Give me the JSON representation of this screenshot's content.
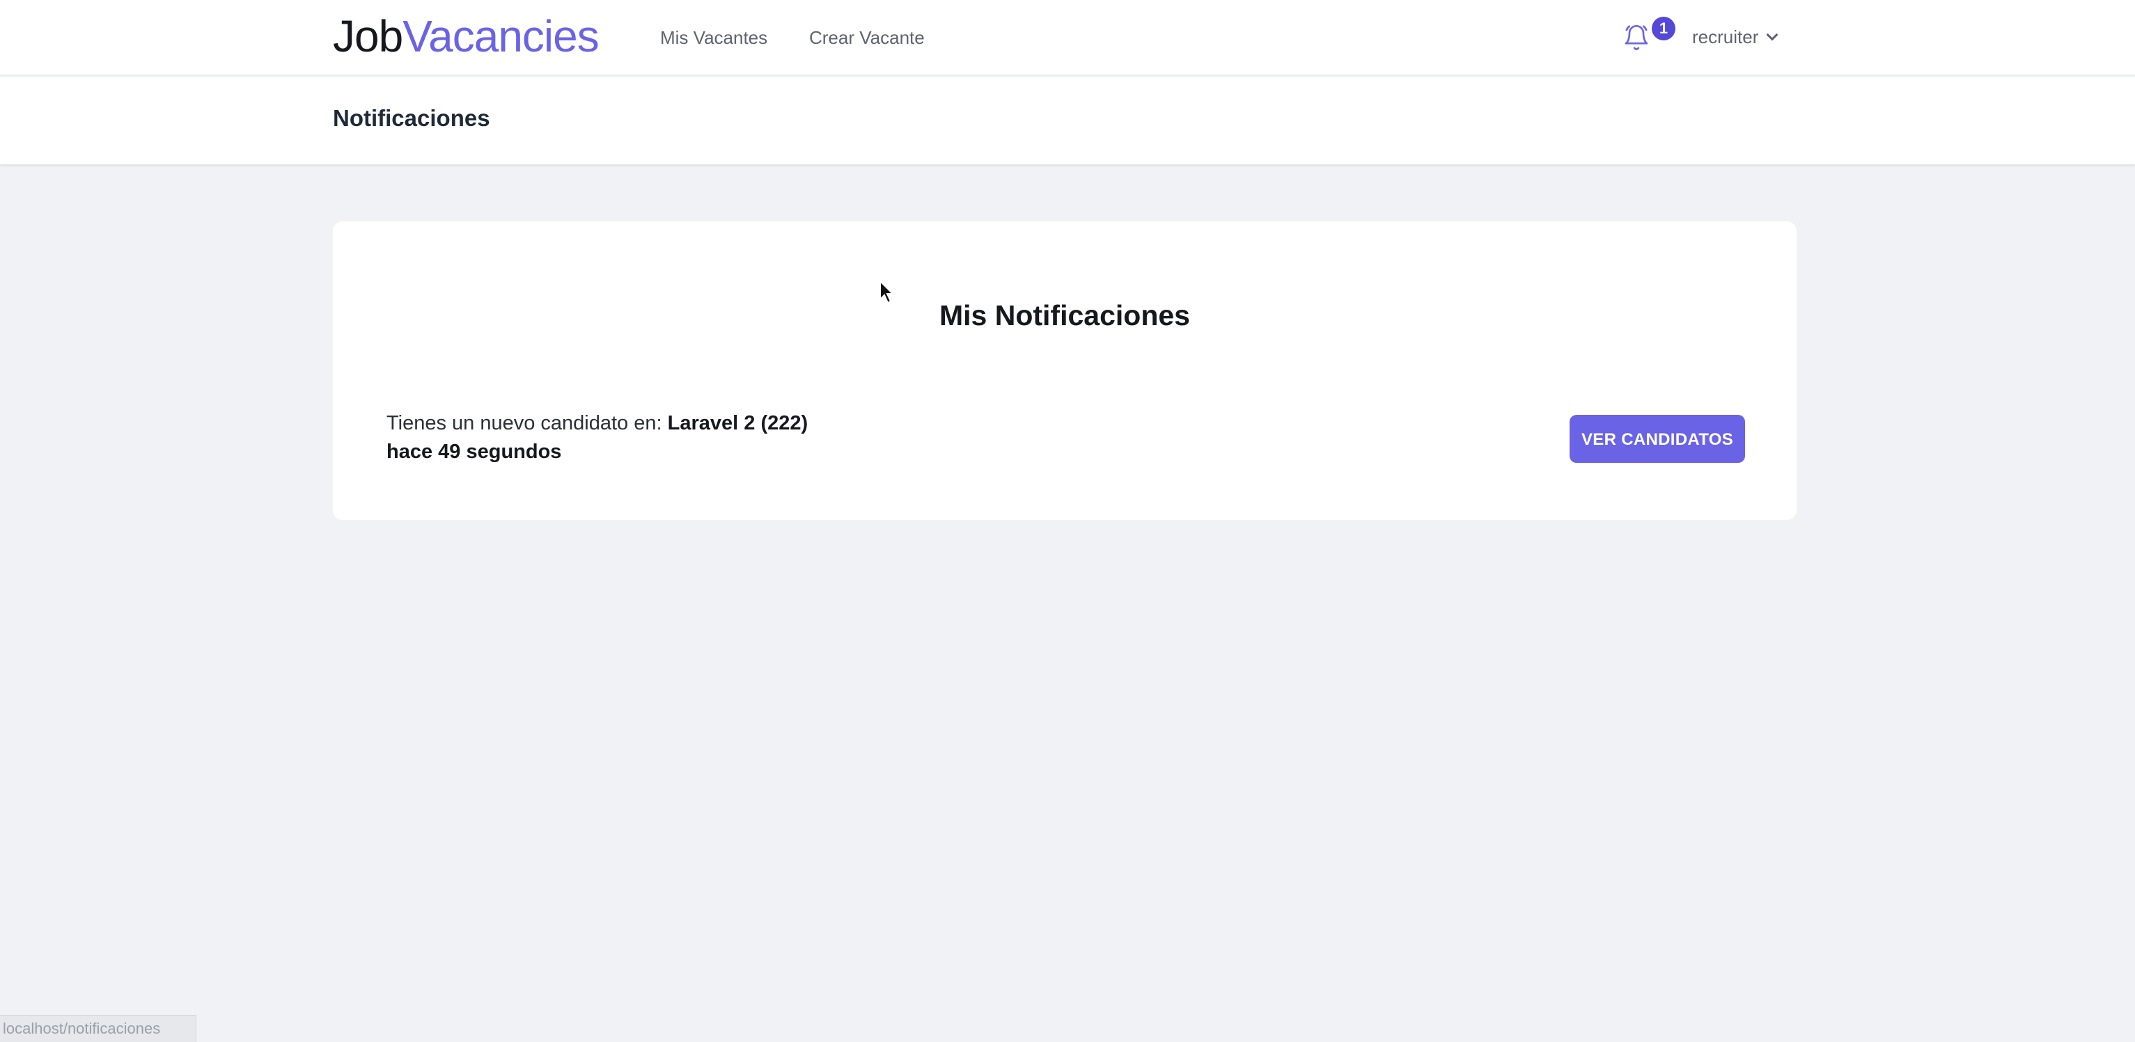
{
  "nav": {
    "logo_job": "Job",
    "logo_vacancies": "Vacancies",
    "links": [
      {
        "label": "Mis Vacantes"
      },
      {
        "label": "Crear Vacante"
      }
    ],
    "notification_count": "1",
    "user_name": "recruiter",
    "icons": {
      "bell": "bell-icon",
      "user_menu": "chevron-down-icon"
    }
  },
  "header": {
    "title": "Notificaciones"
  },
  "main": {
    "title": "Mis Notificaciones",
    "notifications": [
      {
        "prefix": "Tienes un nuevo candidato en:",
        "vacancy": "Laravel 2 (222)",
        "time": "hace 49 segundos",
        "button_label": "VER CANDIDATOS"
      }
    ]
  },
  "status_bar": {
    "url": "localhost/notificaciones"
  },
  "colors": {
    "accent": "#6a63e6",
    "badge": "#5448d9",
    "background": "#f1f2f6"
  }
}
